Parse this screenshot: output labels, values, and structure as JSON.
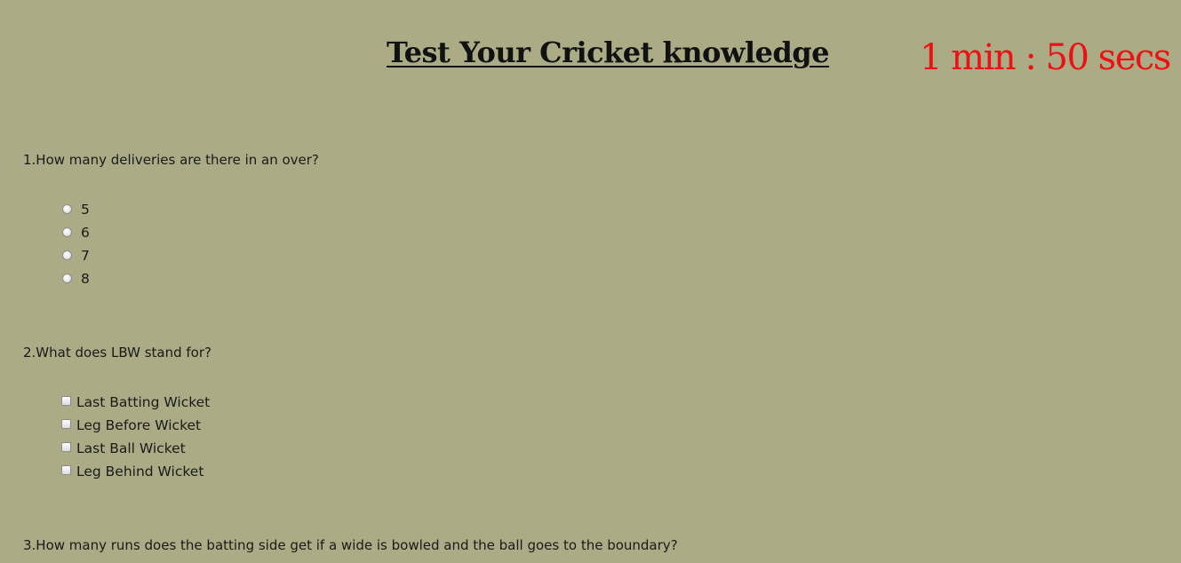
{
  "header": {
    "title": "Test Your Cricket knowledge",
    "timer": "1 min : 50 secs",
    "timer_color": "#ee1111"
  },
  "questions": [
    {
      "text": "1.How many deliveries are there in an over?",
      "input_type": "radio",
      "options": [
        "5",
        "6",
        "7",
        "8"
      ]
    },
    {
      "text": "2.What does LBW stand for?",
      "input_type": "checkbox",
      "options": [
        "Last Batting Wicket",
        "Leg Before Wicket",
        "Last Ball Wicket",
        "Leg Behind Wicket"
      ]
    },
    {
      "text": "3.How many runs does the batting side get if a wide is bowled and the ball goes to the boundary?"
    }
  ],
  "colors": {
    "background": "#abab85"
  }
}
